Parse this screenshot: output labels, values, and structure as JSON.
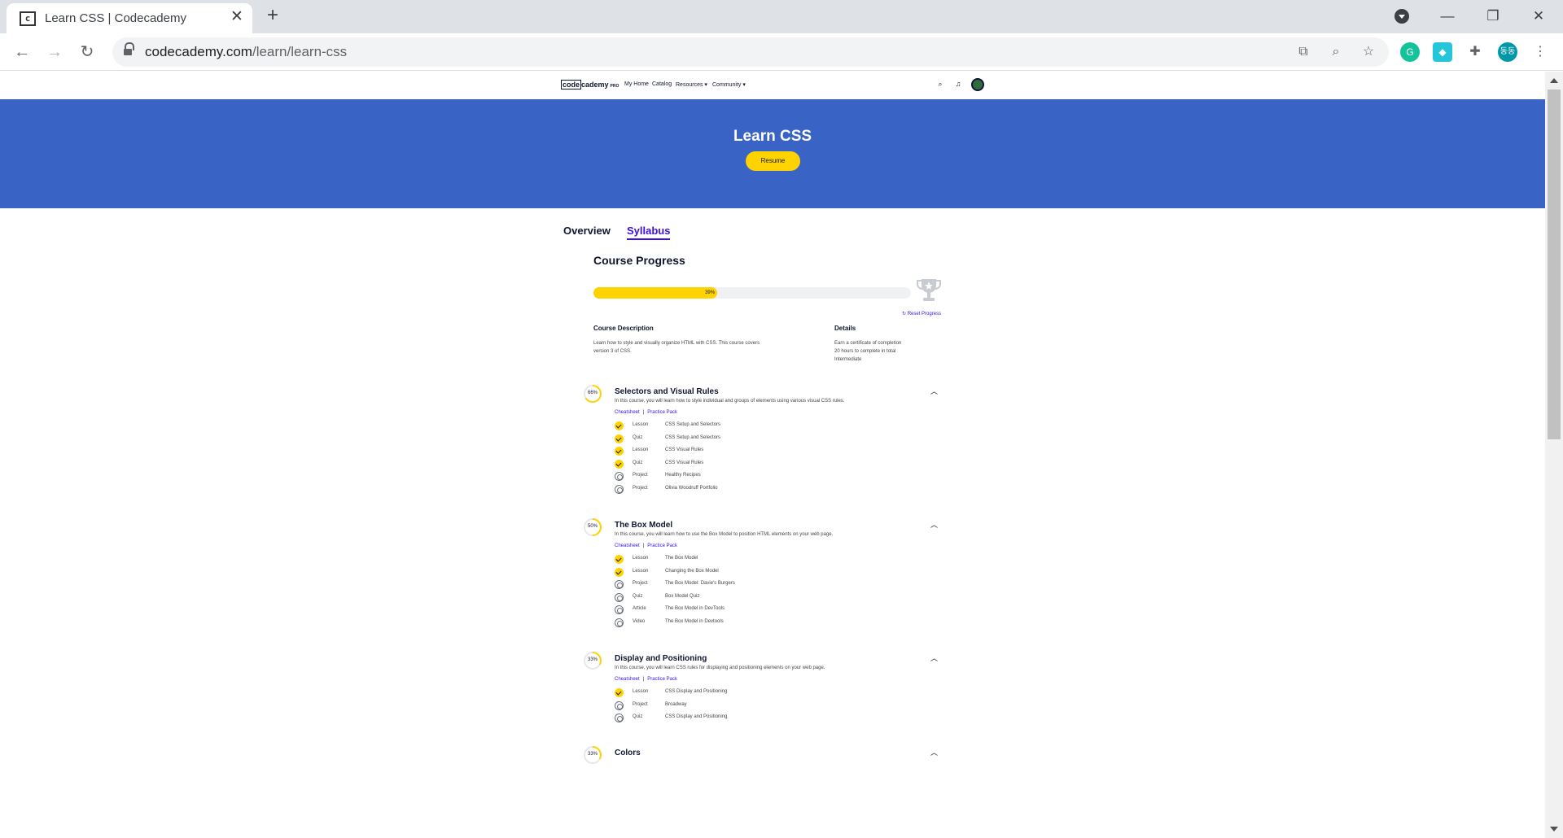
{
  "browser": {
    "tab_title": "Learn CSS | Codecademy",
    "favicon_text": "c",
    "url_domain": "codecademy.com",
    "url_path": "/learn/learn-css",
    "profile_initials": "동동"
  },
  "site": {
    "logo_code": "code",
    "logo_rest": "cademy",
    "logo_pro": "PRO",
    "nav": {
      "my_home": "My Home",
      "catalog": "Catalog",
      "resources": "Resources ▾",
      "community": "Community ▾"
    }
  },
  "hero": {
    "title": "Learn CSS",
    "resume_label": "Resume"
  },
  "tabs": {
    "overview": "Overview",
    "syllabus": "Syllabus"
  },
  "progress": {
    "title": "Course Progress",
    "percent": 39,
    "percent_label": "39%",
    "reset_label": "Reset Progress"
  },
  "description": {
    "heading": "Course Description",
    "text": [
      "Learn how to style and visually organize HTML with CSS. This course covers",
      "version 3 of CSS."
    ],
    "details_heading": "Details",
    "details": [
      "Earn a certificate of completion",
      "20 hours to complete in total",
      "Intermediate"
    ]
  },
  "links": {
    "cheatsheet": "Cheatsheet",
    "separator": "|",
    "practice": "Practice Pack"
  },
  "sections": [
    {
      "title": "Selectors and Visual Rules",
      "percent": 66,
      "percent_label": "66%",
      "desc": "In this course, you will learn how to style individual and groups of elements using various visual CSS rules.",
      "items": [
        {
          "type": "Lesson",
          "name": "CSS Setup and Selectors",
          "done": true
        },
        {
          "type": "Quiz",
          "name": "CSS Setup and Selectors",
          "done": true
        },
        {
          "type": "Lesson",
          "name": "CSS Visual Rules",
          "done": true
        },
        {
          "type": "Quiz",
          "name": "CSS Visual Rules",
          "done": true
        },
        {
          "type": "Project",
          "name": "Healthy Recipes",
          "done": false
        },
        {
          "type": "Project",
          "name": "Olivia Woodruff Portfolio",
          "done": false
        }
      ]
    },
    {
      "title": "The Box Model",
      "percent": 50,
      "percent_label": "50%",
      "desc": "In this course, you will learn how to use the Box Model to position HTML elements on your web page.",
      "items": [
        {
          "type": "Lesson",
          "name": "The Box Model",
          "done": true
        },
        {
          "type": "Lesson",
          "name": "Changing the Box Model",
          "done": true
        },
        {
          "type": "Project",
          "name": "The Box Model: Davie's Burgers",
          "done": false
        },
        {
          "type": "Quiz",
          "name": "Box Model Quiz",
          "done": false
        },
        {
          "type": "Article",
          "name": "The Box Model in DevTools",
          "done": false
        },
        {
          "type": "Video",
          "name": "The Box Model in Devtools",
          "done": false
        }
      ]
    },
    {
      "title": "Display and Positioning",
      "percent": 33,
      "percent_label": "33%",
      "desc": "In this course, you will learn CSS rules for displaying and positioning elements on your web page.",
      "items": [
        {
          "type": "Lesson",
          "name": "CSS Display and Positioning",
          "done": true
        },
        {
          "type": "Project",
          "name": "Broadway",
          "done": false
        },
        {
          "type": "Quiz",
          "name": "CSS Display and Positioning",
          "done": false
        }
      ]
    },
    {
      "title": "Colors",
      "percent": 33,
      "percent_label": "33%",
      "desc": "",
      "items": []
    }
  ],
  "colors": {
    "hero": "#3a63c6",
    "accent": "#ffd300",
    "link": "#3a10e5"
  }
}
